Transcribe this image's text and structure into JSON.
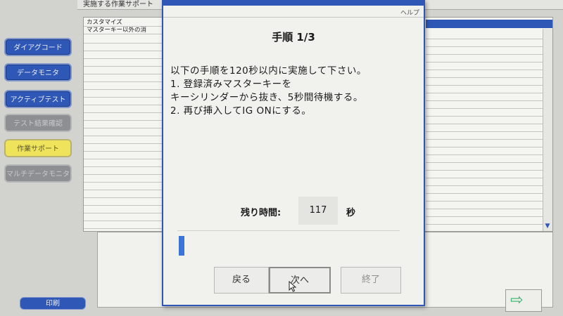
{
  "window": {
    "title": "実施する作業サポート"
  },
  "nav": {
    "items": [
      {
        "label": "ダイアグコード",
        "state": "active"
      },
      {
        "label": "データモニタ",
        "state": "active"
      },
      {
        "label": "アクティブテスト",
        "state": "active"
      },
      {
        "label": "テスト結果確認",
        "state": "disabled"
      },
      {
        "label": "作業サポート",
        "state": "selected"
      },
      {
        "label": "マルチデータモニタ",
        "state": "disabled"
      }
    ],
    "print_label": "印刷"
  },
  "list": {
    "header": "カスタマイズ",
    "item": "マスターキー以外の消"
  },
  "modal": {
    "help_label": "ヘルプ",
    "step_title": "手順 1/3",
    "instructions": [
      "以下の手順を120秒以内に実施して下さい。",
      "1. 登録済みマスターキーを",
      "キーシリンダーから抜き、5秒間待機する。",
      "2. 再び挿入してIG ONにする。"
    ],
    "timer_label": "残り時間:",
    "timer_value": "117",
    "timer_unit": "秒",
    "progress_fraction": 0.025,
    "buttons": {
      "back": "戻る",
      "next": "次へ",
      "end": "終了"
    }
  },
  "colors": {
    "accent_blue": "#2f57b6",
    "nav_yellow": "#f0e35c",
    "progress_blue": "#3a74d6",
    "arrow_green": "#33b56a"
  }
}
